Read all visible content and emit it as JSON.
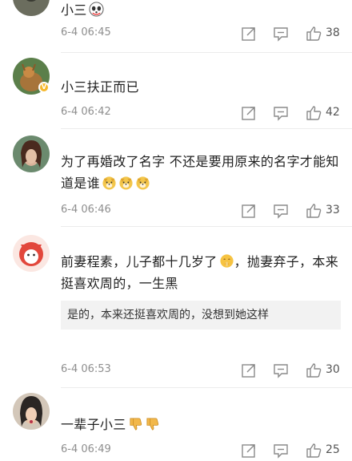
{
  "comments": [
    {
      "username": "",
      "text": "小三",
      "emojis": [
        "panda-face-emoji"
      ],
      "time": "6-4 06:45",
      "likes": "38"
    },
    {
      "username": "",
      "text": "小三扶正而已",
      "emojis": [],
      "time": "6-4 06:42",
      "likes": "42"
    },
    {
      "username": "",
      "text": "为了再婚改了名字 不还是要用原来的名字才能知道是谁",
      "emojis": [
        "doge-emoji",
        "doge-emoji",
        "doge-emoji"
      ],
      "time": "6-4 06:46",
      "likes": "33"
    },
    {
      "username": "",
      "text": "前妻程素，儿子都十几岁了",
      "text2": "，抛妻弃子，本来挺喜欢周的，一生黑",
      "emojis": [
        "shush-emoji"
      ],
      "reply": {
        "name": "",
        "text": "是的，本来还挺喜欢周的，没想到她这样"
      },
      "time": "6-4 06:53",
      "likes": "30"
    },
    {
      "username": "",
      "text": "一辈子小三",
      "emojis": [
        "thumbs-down-emoji",
        "thumbs-down-emoji"
      ],
      "time": "6-4 06:49",
      "likes": "25"
    }
  ],
  "colors": {
    "icon": "#8a8a8a",
    "time": "#8e8e8e",
    "reply_bg": "#f2f2f2",
    "badge": "#f6b72b"
  }
}
